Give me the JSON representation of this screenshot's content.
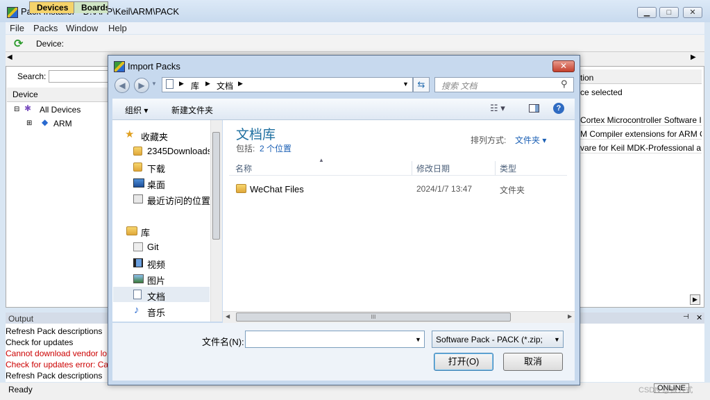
{
  "window": {
    "title": "Pack Installer - D:\\APP\\Keil\\ARM\\PACK",
    "min": "▁",
    "max": "□",
    "close": "✕"
  },
  "menu": [
    "File",
    "Packs",
    "Window",
    "Help"
  ],
  "toolbar": {
    "device_label": "Device:"
  },
  "tabs": {
    "devices": "Devices",
    "boards": "Boards"
  },
  "left": {
    "search_label": "Search:",
    "col_device": "Device",
    "tree": [
      "All Devices",
      "ARM"
    ]
  },
  "right": {
    "col_description": "tion",
    "selected": "ce selected",
    "rows": [
      "Cortex Microcontroller Software I",
      "M Compiler extensions for ARM C",
      "vare for Keil MDK-Professional ar"
    ]
  },
  "output": {
    "title": "Output",
    "lines": [
      {
        "text": "Refresh Pack descriptions",
        "color": "#000000"
      },
      {
        "text": "Check for updates",
        "color": "#000000"
      },
      {
        "text": "Cannot download vendor lo",
        "color": "#cc0000"
      },
      {
        "text": "Check for updates error: Car",
        "color": "#cc0000"
      },
      {
        "text": "Refresh Pack descriptions",
        "color": "#000000"
      }
    ]
  },
  "status": {
    "ready": "Ready",
    "online": "ONLINE",
    "watermark": "CSDN @嵌入式"
  },
  "dialog": {
    "title": "Import Packs",
    "close": "✕",
    "breadcrumb": [
      "库",
      "文档"
    ],
    "search_placeholder": "搜索 文档",
    "organize": "组织 ▾",
    "new_folder": "新建文件夹",
    "nav": {
      "favorites": "收藏夹",
      "fav_items": [
        "2345Downloads",
        "下载",
        "桌面",
        "最近访问的位置"
      ],
      "libraries": "库",
      "lib_items": [
        "Git",
        "视频",
        "图片",
        "文档",
        "音乐"
      ]
    },
    "library_title": "文档库",
    "includes_label": "包括:",
    "includes_link": "2 个位置",
    "sort_label": "排列方式:",
    "sort_value": "文件夹 ▾",
    "columns": {
      "name": "名称",
      "date": "修改日期",
      "type": "类型"
    },
    "files": [
      {
        "name": "WeChat Files",
        "date": "2024/1/7 13:47",
        "type": "文件夹"
      }
    ],
    "filename_label": "文件名(N):",
    "filename_value": "",
    "filetype": "Software Pack - PACK (*.zip;",
    "open": "打开(O)",
    "cancel": "取消"
  }
}
